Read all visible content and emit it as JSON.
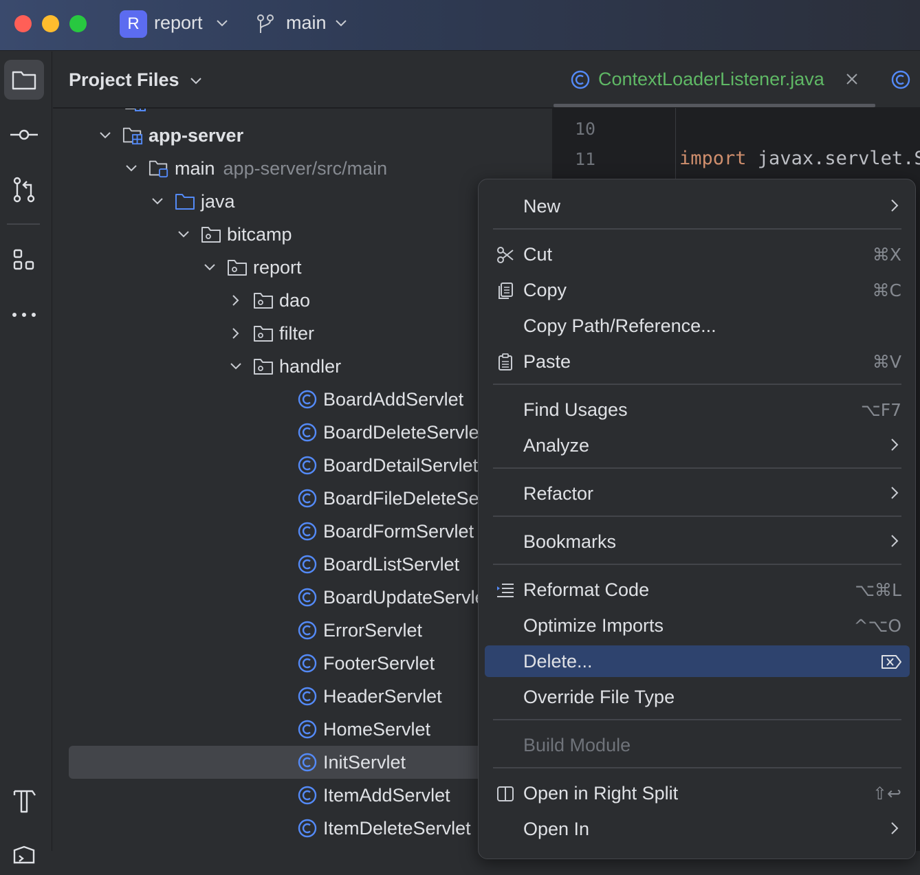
{
  "titlebar": {
    "project_badge": "R",
    "project_name": "report",
    "branch_name": "main"
  },
  "toolstrip": {
    "items": [
      "folder-icon",
      "commit-icon",
      "pull-requests-icon",
      "structure-icon",
      "more-icon",
      "build-icon",
      "terminal-icon"
    ]
  },
  "project_panel": {
    "title": "Project Files",
    "tree": [
      {
        "label": "app-server",
        "bold": true
      },
      {
        "label": "main",
        "hint": "app-server/src/main"
      },
      {
        "label": "java"
      },
      {
        "label": "bitcamp"
      },
      {
        "label": "report"
      },
      {
        "label": "dao"
      },
      {
        "label": "filter"
      },
      {
        "label": "handler"
      },
      {
        "label": "BoardAddServlet"
      },
      {
        "label": "BoardDeleteServlet"
      },
      {
        "label": "BoardDetailServlet"
      },
      {
        "label": "BoardFileDeleteServ"
      },
      {
        "label": "BoardFormServlet"
      },
      {
        "label": "BoardListServlet"
      },
      {
        "label": "BoardUpdateServlet"
      },
      {
        "label": "ErrorServlet"
      },
      {
        "label": "FooterServlet"
      },
      {
        "label": "HeaderServlet"
      },
      {
        "label": "HomeServlet"
      },
      {
        "label": "InitServlet",
        "selected": true
      },
      {
        "label": "ItemAddServlet"
      },
      {
        "label": "ItemDeleteServlet"
      }
    ]
  },
  "editor": {
    "active_tab": "ContextLoaderListener.java",
    "lines": [
      {
        "number": "10",
        "keyword": "",
        "text": ""
      },
      {
        "number": "11",
        "keyword": "import",
        "text": " javax.servlet.Ser"
      }
    ]
  },
  "context_menu": {
    "items": [
      {
        "label": "New",
        "submenu": true
      },
      {
        "label": "Cut",
        "shortcut": "⌘X",
        "icon": "scissors-icon"
      },
      {
        "label": "Copy",
        "shortcut": "⌘C",
        "icon": "copy-icon"
      },
      {
        "label": "Copy Path/Reference..."
      },
      {
        "label": "Paste",
        "shortcut": "⌘V",
        "icon": "paste-icon"
      },
      {
        "label": "Find Usages",
        "shortcut": "⌥F7"
      },
      {
        "label": "Analyze",
        "submenu": true
      },
      {
        "label": "Refactor",
        "submenu": true
      },
      {
        "label": "Bookmarks",
        "submenu": true
      },
      {
        "label": "Reformat Code",
        "shortcut": "⌥⌘L",
        "icon": "reformat-icon"
      },
      {
        "label": "Optimize Imports",
        "shortcut": "^⌥O"
      },
      {
        "label": "Delete...",
        "shortcut": "⌦",
        "highlighted": true
      },
      {
        "label": "Override File Type"
      },
      {
        "label": "Build Module",
        "disabled": true
      },
      {
        "label": "Open in Right Split",
        "shortcut": "⇧↩",
        "icon": "split-icon"
      },
      {
        "label": "Open In",
        "submenu": true
      }
    ]
  },
  "colors": {
    "accent": "#5c6cf0",
    "tab_text": "#5fb865",
    "highlight": "#2e436e",
    "class_icon": "#548af7"
  }
}
